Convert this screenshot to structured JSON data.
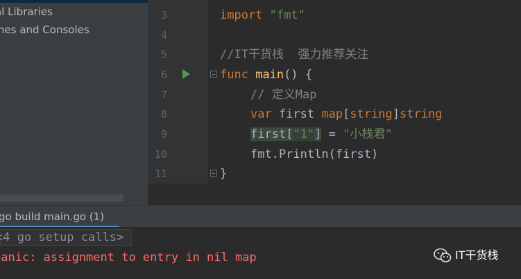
{
  "sidebar": {
    "items": [
      "al Libraries",
      "nes and Consoles"
    ]
  },
  "editor": {
    "line_numbers": [
      "3",
      "4",
      "5",
      "6",
      "7",
      "8",
      "9",
      "10",
      "11"
    ],
    "code": {
      "l3_kw": "import",
      "l3_str": "\"fmt\"",
      "l5_comment": "//IT干货栈  强力推荐关注",
      "l6_kw": "func",
      "l6_fn": "main",
      "l6_rest": "() {",
      "l7_comment": "// 定义Map",
      "l8_kw": "var",
      "l8_mid": " first ",
      "l8_map": "map",
      "l8_lb": "[",
      "l8_string1": "string",
      "l8_rb": "]",
      "l8_string2": "string",
      "l9_first": "first",
      "l9_lb": "[",
      "l9_key": "\"1\"",
      "l9_rb": "]",
      "l9_eq": " = ",
      "l9_val": "\"小栈君\"",
      "l10_pkg": "fmt.",
      "l10_fn": "Println",
      "l10_rest": "(first)",
      "l11_close": "}"
    }
  },
  "run": {
    "tab_label": "go build main.go (1)",
    "console_lines": [
      "<4 go setup calls>",
      "panic: assignment to entry in nil map"
    ]
  },
  "watermark": {
    "text": "IT干货栈",
    "icon": "wechat-icon"
  },
  "colors": {
    "keyword": "#cc7832",
    "string": "#6a8759",
    "comment": "#808080",
    "function": "#ffc66d",
    "error": "#ff6b68"
  }
}
